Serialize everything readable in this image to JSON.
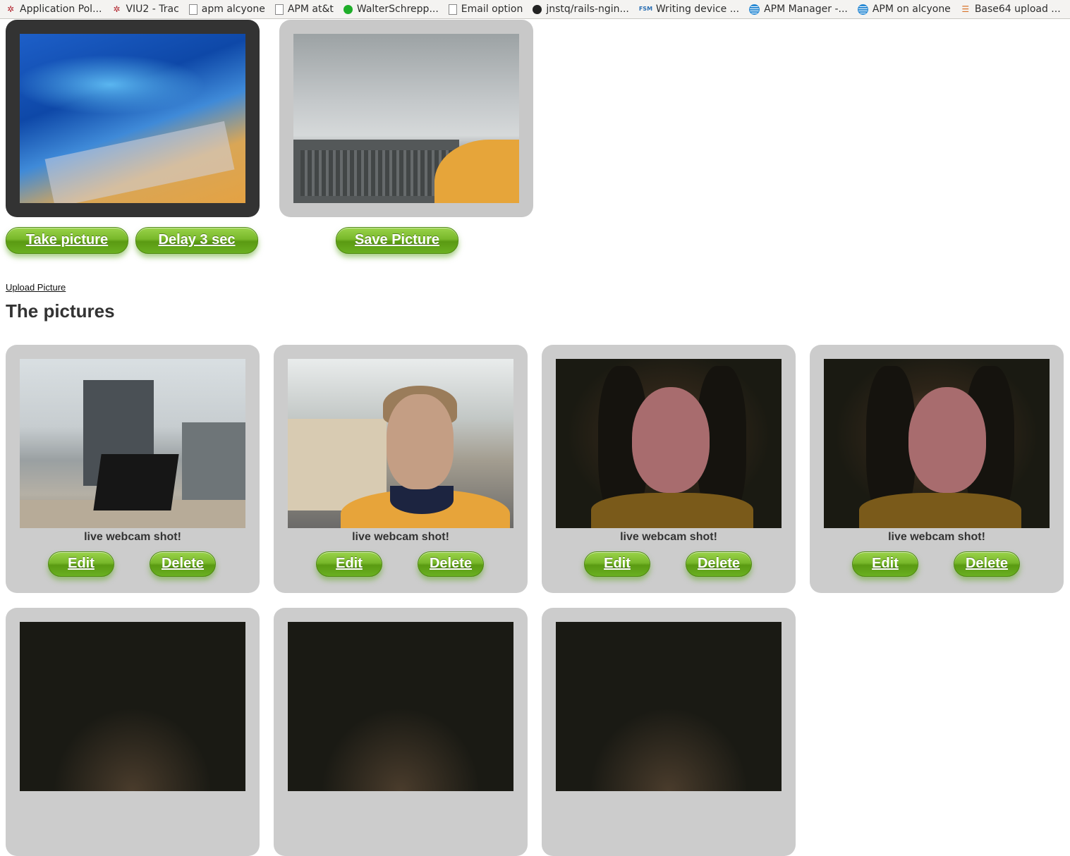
{
  "bookmarks": [
    {
      "label": "Application Pol...",
      "icon": "bug-icon"
    },
    {
      "label": "VIU2 - Trac",
      "icon": "bug-icon"
    },
    {
      "label": "apm alcyone",
      "icon": "document-icon"
    },
    {
      "label": "APM at&t",
      "icon": "document-icon"
    },
    {
      "label": "WalterSchrepp...",
      "icon": "green-circle-icon"
    },
    {
      "label": "Email option",
      "icon": "document-icon"
    },
    {
      "label": "jnstq/rails-ngin...",
      "icon": "github-icon"
    },
    {
      "label": "Writing device ...",
      "icon": "fsm-icon"
    },
    {
      "label": "APM Manager -...",
      "icon": "att-globe-icon"
    },
    {
      "label": "APM on alcyone",
      "icon": "att-globe-icon"
    },
    {
      "label": "Base64 upload ...",
      "icon": "stackoverflow-icon"
    }
  ],
  "camera": {
    "take_picture": "Take picture",
    "delay": "Delay 3 sec",
    "save_picture": "Save Picture"
  },
  "upload_link": "Upload Picture",
  "section_title": "The pictures",
  "pictures": [
    {
      "caption": "live webcam shot!",
      "edit": "Edit",
      "delete": "Delete"
    },
    {
      "caption": "live webcam shot!",
      "edit": "Edit",
      "delete": "Delete"
    },
    {
      "caption": "live webcam shot!",
      "edit": "Edit",
      "delete": "Delete"
    },
    {
      "caption": "live webcam shot!",
      "edit": "Edit",
      "delete": "Delete"
    }
  ],
  "colors": {
    "button_green": "#6ab021",
    "card_gray": "#cccccc",
    "live_frame": "#333333"
  }
}
